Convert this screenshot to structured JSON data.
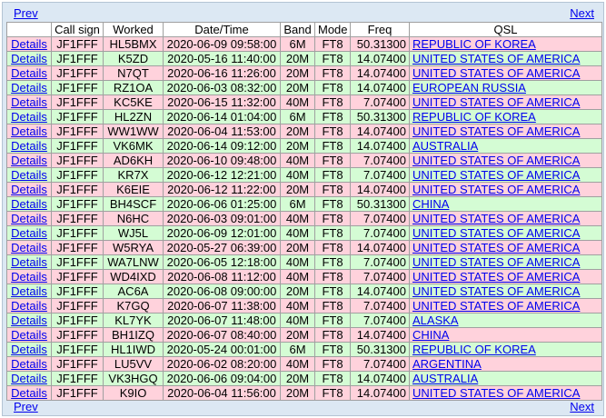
{
  "nav": {
    "prev_label": "Prev",
    "next_label": "Next"
  },
  "columns": [
    "",
    "Call sign",
    "Worked",
    "Date/Time",
    "Band",
    "Mode",
    "Freq",
    "QSL"
  ],
  "details_label": "Details",
  "colors": {
    "row_pink": "#ffd2dc",
    "row_green": "#d4fcd4",
    "link": "#0000ee",
    "frame_bg": "#dce8f3"
  },
  "rows": [
    {
      "call": "JF1FFF",
      "worked": "HL5BMX",
      "datetime": "2020-06-09 09:58:00",
      "band": "6M",
      "mode": "FT8",
      "freq": "50.31300",
      "qsl": "REPUBLIC OF KOREA",
      "row_color": "pink"
    },
    {
      "call": "JF1FFF",
      "worked": "K5ZD",
      "datetime": "2020-05-16 11:40:00",
      "band": "20M",
      "mode": "FT8",
      "freq": "14.07400",
      "qsl": "UNITED STATES OF AMERICA",
      "row_color": "green"
    },
    {
      "call": "JF1FFF",
      "worked": "N7QT",
      "datetime": "2020-06-16 11:26:00",
      "band": "20M",
      "mode": "FT8",
      "freq": "14.07400",
      "qsl": "UNITED STATES OF AMERICA",
      "row_color": "pink"
    },
    {
      "call": "JF1FFF",
      "worked": "RZ1OA",
      "datetime": "2020-06-03 08:32:00",
      "band": "20M",
      "mode": "FT8",
      "freq": "14.07400",
      "qsl": "EUROPEAN RUSSIA",
      "row_color": "green"
    },
    {
      "call": "JF1FFF",
      "worked": "KC5KE",
      "datetime": "2020-06-15 11:32:00",
      "band": "40M",
      "mode": "FT8",
      "freq": "7.07400",
      "qsl": "UNITED STATES OF AMERICA",
      "row_color": "pink"
    },
    {
      "call": "JF1FFF",
      "worked": "HL2ZN",
      "datetime": "2020-06-14 01:04:00",
      "band": "6M",
      "mode": "FT8",
      "freq": "50.31300",
      "qsl": "REPUBLIC OF KOREA",
      "row_color": "green"
    },
    {
      "call": "JF1FFF",
      "worked": "WW1WW",
      "datetime": "2020-06-04 11:53:00",
      "band": "20M",
      "mode": "FT8",
      "freq": "14.07400",
      "qsl": "UNITED STATES OF AMERICA",
      "row_color": "pink"
    },
    {
      "call": "JF1FFF",
      "worked": "VK6MK",
      "datetime": "2020-06-14 09:12:00",
      "band": "20M",
      "mode": "FT8",
      "freq": "14.07400",
      "qsl": "AUSTRALIA",
      "row_color": "green"
    },
    {
      "call": "JF1FFF",
      "worked": "AD6KH",
      "datetime": "2020-06-10 09:48:00",
      "band": "40M",
      "mode": "FT8",
      "freq": "7.07400",
      "qsl": "UNITED STATES OF AMERICA",
      "row_color": "pink"
    },
    {
      "call": "JF1FFF",
      "worked": "KR7X",
      "datetime": "2020-06-12 12:21:00",
      "band": "40M",
      "mode": "FT8",
      "freq": "7.07400",
      "qsl": "UNITED STATES OF AMERICA",
      "row_color": "green"
    },
    {
      "call": "JF1FFF",
      "worked": "K6EIE",
      "datetime": "2020-06-12 11:22:00",
      "band": "20M",
      "mode": "FT8",
      "freq": "14.07400",
      "qsl": "UNITED STATES OF AMERICA",
      "row_color": "pink"
    },
    {
      "call": "JF1FFF",
      "worked": "BH4SCF",
      "datetime": "2020-06-06 01:25:00",
      "band": "6M",
      "mode": "FT8",
      "freq": "50.31300",
      "qsl": "CHINA",
      "row_color": "green"
    },
    {
      "call": "JF1FFF",
      "worked": "N6HC",
      "datetime": "2020-06-03 09:01:00",
      "band": "40M",
      "mode": "FT8",
      "freq": "7.07400",
      "qsl": "UNITED STATES OF AMERICA",
      "row_color": "pink"
    },
    {
      "call": "JF1FFF",
      "worked": "WJ5L",
      "datetime": "2020-06-09 12:01:00",
      "band": "40M",
      "mode": "FT8",
      "freq": "7.07400",
      "qsl": "UNITED STATES OF AMERICA",
      "row_color": "green"
    },
    {
      "call": "JF1FFF",
      "worked": "W5RYA",
      "datetime": "2020-05-27 06:39:00",
      "band": "20M",
      "mode": "FT8",
      "freq": "14.07400",
      "qsl": "UNITED STATES OF AMERICA",
      "row_color": "pink"
    },
    {
      "call": "JF1FFF",
      "worked": "WA7LNW",
      "datetime": "2020-06-05 12:18:00",
      "band": "40M",
      "mode": "FT8",
      "freq": "7.07400",
      "qsl": "UNITED STATES OF AMERICA",
      "row_color": "green"
    },
    {
      "call": "JF1FFF",
      "worked": "WD4IXD",
      "datetime": "2020-06-08 11:12:00",
      "band": "40M",
      "mode": "FT8",
      "freq": "7.07400",
      "qsl": "UNITED STATES OF AMERICA",
      "row_color": "pink"
    },
    {
      "call": "JF1FFF",
      "worked": "AC6A",
      "datetime": "2020-06-08 09:00:00",
      "band": "20M",
      "mode": "FT8",
      "freq": "14.07400",
      "qsl": "UNITED STATES OF AMERICA",
      "row_color": "green"
    },
    {
      "call": "JF1FFF",
      "worked": "K7GQ",
      "datetime": "2020-06-07 11:38:00",
      "band": "40M",
      "mode": "FT8",
      "freq": "7.07400",
      "qsl": "UNITED STATES OF AMERICA",
      "row_color": "pink"
    },
    {
      "call": "JF1FFF",
      "worked": "KL7YK",
      "datetime": "2020-06-07 11:48:00",
      "band": "40M",
      "mode": "FT8",
      "freq": "7.07400",
      "qsl": "ALASKA",
      "row_color": "green"
    },
    {
      "call": "JF1FFF",
      "worked": "BH1IZQ",
      "datetime": "2020-06-07 08:40:00",
      "band": "20M",
      "mode": "FT8",
      "freq": "14.07400",
      "qsl": "CHINA",
      "row_color": "pink"
    },
    {
      "call": "JF1FFF",
      "worked": "HL1IWD",
      "datetime": "2020-05-24 00:01:00",
      "band": "6M",
      "mode": "FT8",
      "freq": "50.31300",
      "qsl": "REPUBLIC OF KOREA",
      "row_color": "green"
    },
    {
      "call": "JF1FFF",
      "worked": "LU5VV",
      "datetime": "2020-06-02 08:20:00",
      "band": "40M",
      "mode": "FT8",
      "freq": "7.07400",
      "qsl": "ARGENTINA",
      "row_color": "pink"
    },
    {
      "call": "JF1FFF",
      "worked": "VK3HGQ",
      "datetime": "2020-06-06 09:04:00",
      "band": "20M",
      "mode": "FT8",
      "freq": "14.07400",
      "qsl": "AUSTRALIA",
      "row_color": "green"
    },
    {
      "call": "JF1FFF",
      "worked": "K9IO",
      "datetime": "2020-06-04 11:56:00",
      "band": "20M",
      "mode": "FT8",
      "freq": "14.07400",
      "qsl": "UNITED STATES OF AMERICA",
      "row_color": "pink"
    }
  ]
}
